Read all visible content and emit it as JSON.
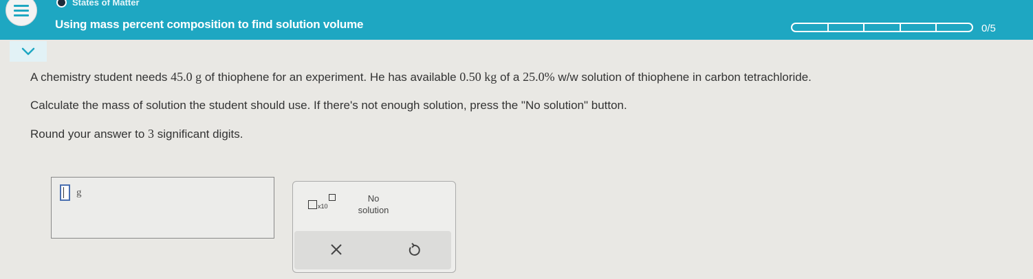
{
  "header": {
    "topic": "States of Matter",
    "title": "Using mass percent composition to find solution volume",
    "progress_text": "0/5",
    "progress": {
      "completed": 0,
      "total": 5
    }
  },
  "question": {
    "p1_a": "A chemistry student needs ",
    "p1_m1": "45.0 g",
    "p1_b": " of thiophene for an experiment. He has available ",
    "p1_m2": "0.50 kg",
    "p1_c": " of a ",
    "p1_m3": "25.0%",
    "p1_d": " w/w solution of thiophene in carbon tetrachloride.",
    "p2": "Calculate the mass of solution the student should use. If there's not enough solution, press the \"No solution\" button.",
    "p3_a": "Round your answer to ",
    "p3_m": "3",
    "p3_b": " significant digits."
  },
  "answer": {
    "value": "",
    "unit": "g"
  },
  "tools": {
    "sci_label": "x10",
    "no_solution_line1": "No",
    "no_solution_line2": "solution",
    "clear_symbol": "×",
    "undo_symbol": "↺"
  },
  "icons": {
    "menu": "hamburger-icon",
    "collapse": "chevron-down-icon",
    "topic": "dot-icon"
  },
  "colors": {
    "header": "#1ea7c2",
    "background": "#e9e8e4",
    "input_border": "#4a6fb0"
  }
}
